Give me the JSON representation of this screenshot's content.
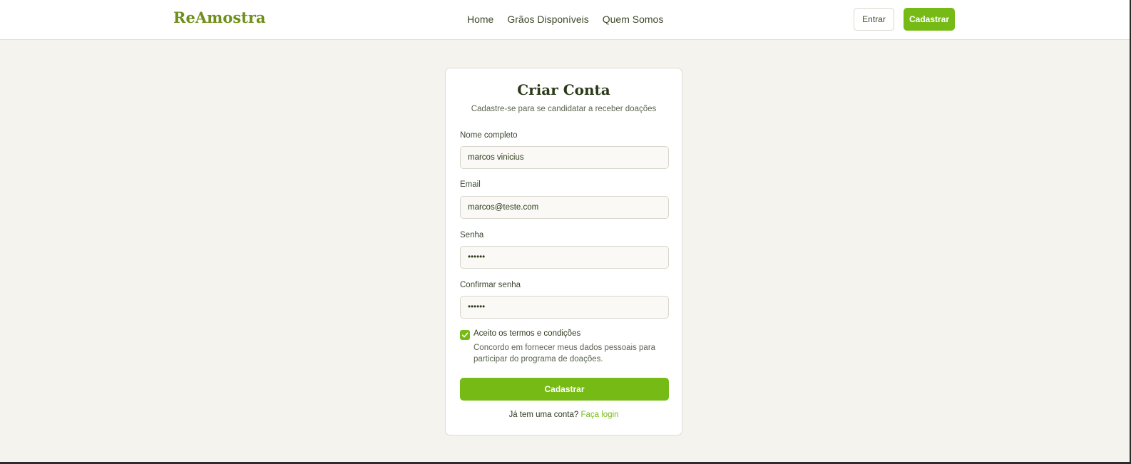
{
  "header": {
    "brand": "ReAmostra",
    "nav": [
      "Home",
      "Grãos Disponíveis",
      "Quem Somos"
    ],
    "login_label": "Entrar",
    "signup_label": "Cadastrar"
  },
  "form": {
    "title": "Criar Conta",
    "subtitle": "Cadastre-se para se candidatar a receber doações",
    "name_label": "Nome completo",
    "name_value": "marcos vinicius",
    "email_label": "Email",
    "email_value": "marcos@teste.com",
    "password_label": "Senha",
    "password_value": "••••••",
    "confirm_label": "Confirmar senha",
    "confirm_value": "••••••",
    "terms_label": "Aceito os termos e condições",
    "terms_checked": true,
    "terms_desc": "Concordo em fornecer meus dados pessoais para participar do programa de doações.",
    "submit_label": "Cadastrar",
    "login_prompt": "Já tem uma conta?",
    "login_link": "Faça login"
  },
  "colors": {
    "accent": "#76bb15",
    "brand": "#6f8f1c",
    "background": "#f4f3ee"
  }
}
